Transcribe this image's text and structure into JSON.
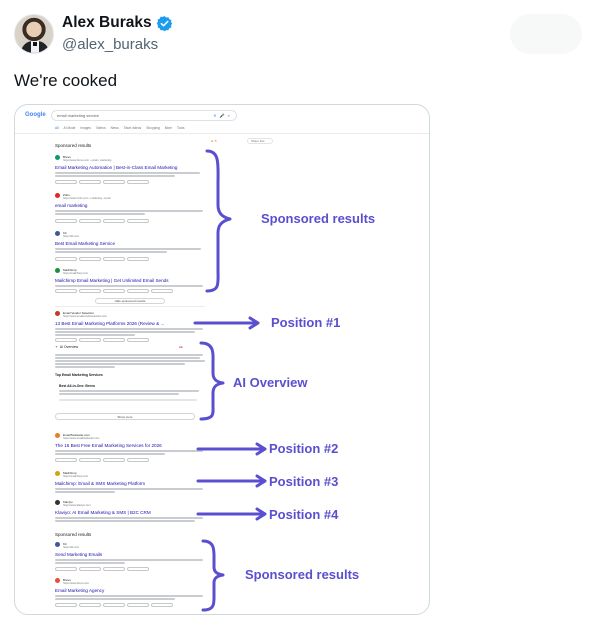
{
  "tweet": {
    "author_name": "Alex Buraks",
    "author_handle": "@alex_buraks",
    "text": "We're cooked"
  },
  "screenshot": {
    "google_logo": "Google",
    "search_query": "email marketing service",
    "search_icons": "✕ 🎤 ⌕",
    "tabs": [
      "All",
      "AI Mode",
      "Images",
      "Videos",
      "News",
      "Short videos",
      "Shopping",
      "More",
      "Tools"
    ],
    "right_pill": "Share this",
    "sponsored_heading": "Sponsored results",
    "top_ads": [
      {
        "site": "Brevo",
        "url": "https://www.brevo.com › email › marketing",
        "title": "Email Marketing Automation | Best-in-Class Email Marketing",
        "color": "#0b996e"
      },
      {
        "site": "Zoho",
        "url": "https://www.zoho.com › marketing › email",
        "title": "email marketing",
        "color": "#e42527"
      },
      {
        "site": "Kit",
        "url": "https://kit.com",
        "title": "Best Email Marketing Service",
        "color": "#3b5998"
      },
      {
        "site": "Mailchimp",
        "url": "https://mailchimp.com",
        "title": "Mailchimp Email Marketing | Get Unlimited Email Sends",
        "color": "#1a8f3c"
      }
    ],
    "more_sponsored": "Hide sponsored results",
    "organic_1": {
      "site": "Email Vendor Selection",
      "url": "https://www.emailvendorselection.com",
      "title": "13 Best Email Marketing Platforms 2026 (Review & ...",
      "color": "#c0392b"
    },
    "ai_overview_label": "AI Overview",
    "ai_overview_bold": "Top Email Marketing Services",
    "ai_bullet_bold": "Best All-in-One: Brevo",
    "show_more": "Show more",
    "organic_2": {
      "site": "EmailTooltester.com",
      "url": "https://www.emailtooltester.com",
      "title": "The 16 Best Free Email Marketing Services for 2026",
      "color": "#e67e22"
    },
    "organic_3": {
      "site": "Mailchimp",
      "url": "https://mailchimp.com",
      "title": "Mailchimp: Email & SMS Marketing Platform",
      "color": "#d4a017"
    },
    "organic_4": {
      "site": "Klaviyo",
      "url": "https://www.klaviyo.com",
      "title": "Klaviyo: AI Email Marketing & SMS | B2C CRM",
      "color": "#333333"
    },
    "bottom_ads": [
      {
        "site": "Kit",
        "url": "https://kit.com",
        "title": "Send Marketing Emails",
        "color": "#3b5998"
      },
      {
        "site": "Brevo",
        "url": "https://www.brevo.com",
        "title": "Email Marketing Agency",
        "color": "#e74c3c"
      }
    ]
  },
  "annotations": {
    "sponsored_top": "Sponsored results",
    "position_1": "Position #1",
    "ai_overview": "AI Overview",
    "position_2": "Position #2",
    "position_3": "Position #3",
    "position_4": "Position #4",
    "sponsored_bottom": "Sponsored results",
    "color": "#5a4fcf"
  }
}
